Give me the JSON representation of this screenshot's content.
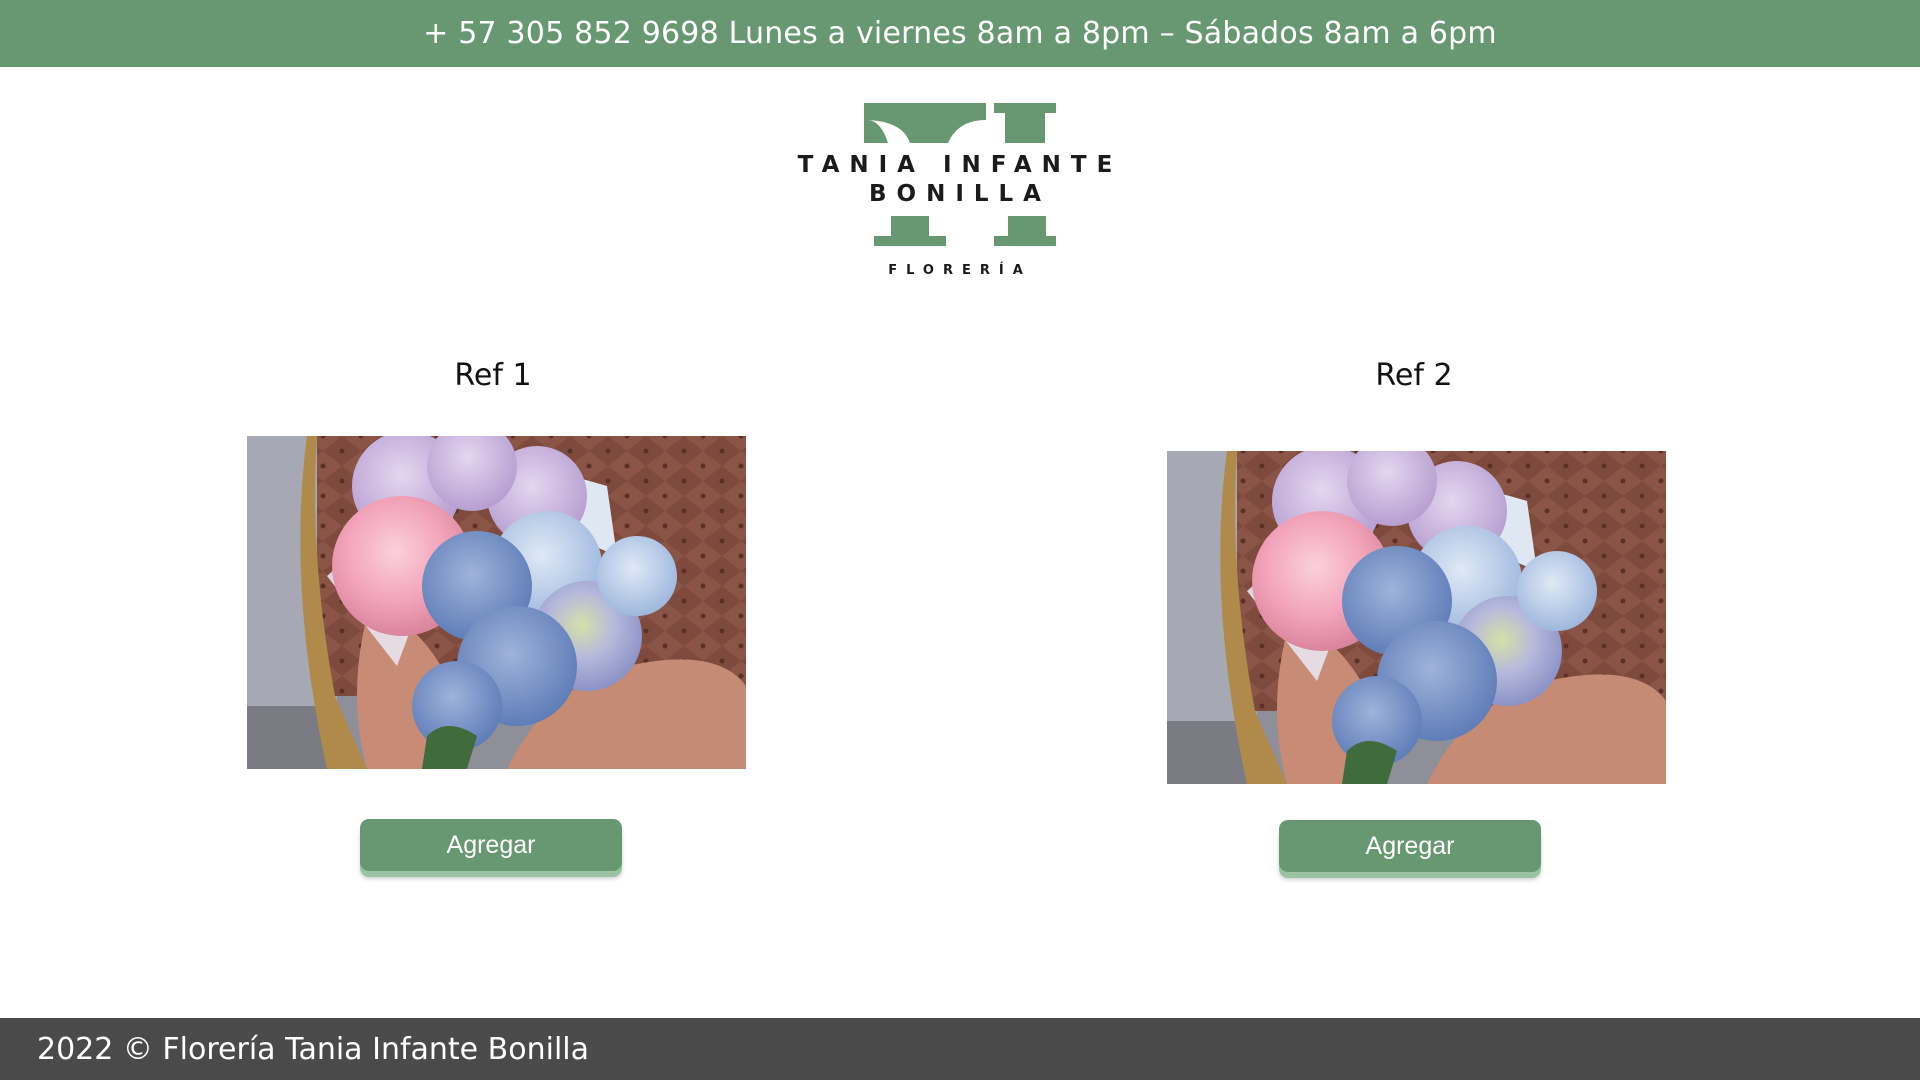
{
  "topbar": {
    "contact_text": "+ 57 305 852 9698 Lunes a viernes 8am a 8pm – Sábados 8am a 6pm",
    "background_color": "#679872"
  },
  "logo": {
    "line1": "TANIA INFANTE",
    "line2": "BONILLA",
    "tagline": "FLORERÍA",
    "brand_color": "#679872"
  },
  "products": [
    {
      "title": "Ref 1",
      "image": "flower-bouquet-photo",
      "button_label": "Agregar"
    },
    {
      "title": "Ref 2",
      "image": "flower-bouquet-photo",
      "button_label": "Agregar"
    }
  ],
  "footer": {
    "copyright": "2022 © Florería Tania Infante Bonilla",
    "background_color": "#4a4a4a"
  }
}
